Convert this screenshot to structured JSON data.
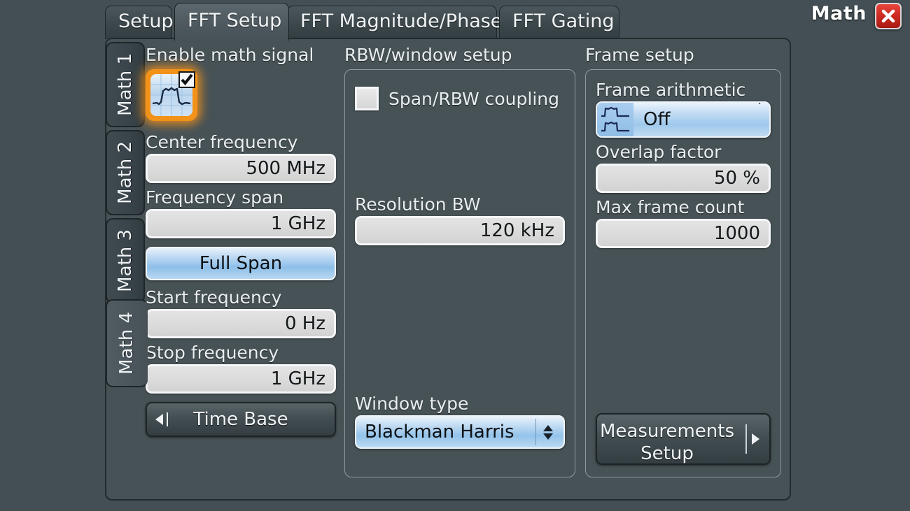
{
  "window": {
    "title": "Math",
    "close_icon": "close-x-icon"
  },
  "tabs": [
    {
      "label": "Setup",
      "selected": false
    },
    {
      "label": "FFT Setup",
      "selected": true
    },
    {
      "label": "FFT Magnitude/Phase",
      "selected": false
    },
    {
      "label": "FFT Gating",
      "selected": false
    }
  ],
  "math_tabs": [
    {
      "label": "Math 1",
      "selected": false
    },
    {
      "label": "Math 2",
      "selected": false
    },
    {
      "label": "Math 3",
      "selected": false
    },
    {
      "label": "Math 4",
      "selected": true
    }
  ],
  "left_column": {
    "title": "Enable math signal",
    "enable": {
      "icon": "math-waveform-icon",
      "checked": true,
      "accent": "#f29219"
    },
    "center_frequency": {
      "label": "Center frequency",
      "value": "500 MHz"
    },
    "frequency_span": {
      "label": "Frequency span",
      "value": "1 GHz"
    },
    "full_span_button": {
      "label": "Full Span"
    },
    "start_frequency": {
      "label": "Start frequency",
      "value": "0 Hz"
    },
    "stop_frequency": {
      "label": "Stop frequency",
      "value": "1 GHz"
    },
    "time_base_button": {
      "label": "Time Base",
      "icon": "caret-left-icon"
    }
  },
  "middle_column": {
    "title": "RBW/window setup",
    "span_rbw_coupling": {
      "label": "Span/RBW coupling",
      "checked": false
    },
    "resolution_bw": {
      "label": "Resolution BW",
      "value": "120 kHz"
    },
    "window_type": {
      "label": "Window type",
      "value": "Blackman Harris",
      "spinner_icon": "spinner-updown-icon"
    }
  },
  "right_column": {
    "title": "Frame setup",
    "frame_arithmetic": {
      "label": "Frame arithmetic",
      "value": "Off",
      "swatch_icon": "dual-pulse-waveform-icon",
      "caret_icon": "caret-down-icon"
    },
    "overlap_factor": {
      "label": "Overlap factor",
      "value": "50 %"
    },
    "max_frame_count": {
      "label": "Max frame count",
      "value": "1000"
    },
    "measurements_setup_button": {
      "line1": "Measurements",
      "line2": "Setup",
      "icon": "caret-right-icon"
    }
  },
  "colors": {
    "background": "#434f54",
    "panel": "#475257",
    "accent_orange": "#f29219",
    "accent_blue": "#8dbfe9",
    "close_red": "#cc2b22"
  }
}
